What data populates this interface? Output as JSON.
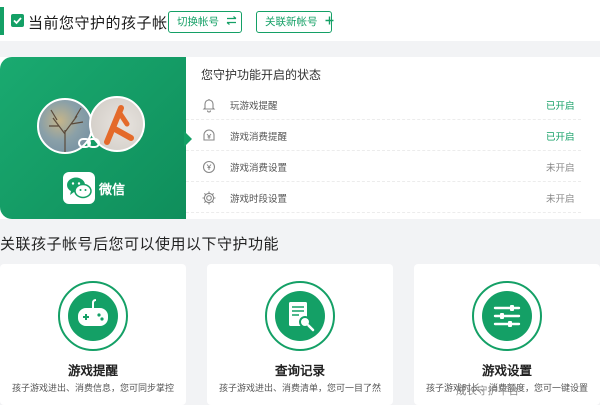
{
  "header": {
    "title": "当前您守护的孩子帐号",
    "switch_label": "切换帐号",
    "link_label": "关联新帐号"
  },
  "status_card": {
    "heading": "您守护功能开启的状态",
    "platform_label": "微信",
    "items": [
      {
        "label": "玩游戏提醒",
        "status": "已开启",
        "icon": "bell-icon"
      },
      {
        "label": "游戏消费提醒",
        "status": "已开启",
        "icon": "yen-bell-icon"
      },
      {
        "label": "游戏消费设置",
        "status": "未开启",
        "icon": "yen-settings-icon"
      },
      {
        "label": "游戏时段设置",
        "status": "未开启",
        "icon": "gear-icon"
      }
    ]
  },
  "features": {
    "title": "关联孩子帐号后您可以使用以下守护功能",
    "cards": [
      {
        "name": "游戏提醒",
        "desc": "孩子游戏进出、消费信息，您可同步掌控",
        "icon": "gamepad-icon"
      },
      {
        "name": "查询记录",
        "desc": "孩子游戏进出、消费清单，您可一目了然",
        "icon": "document-search-icon"
      },
      {
        "name": "游戏设置",
        "desc": "孩子游戏时长、消费额度，您可一键设置",
        "icon": "sliders-icon"
      }
    ]
  },
  "watermark": "成长守护平台",
  "colors": {
    "accent": "#14a066",
    "off": "#888888"
  }
}
